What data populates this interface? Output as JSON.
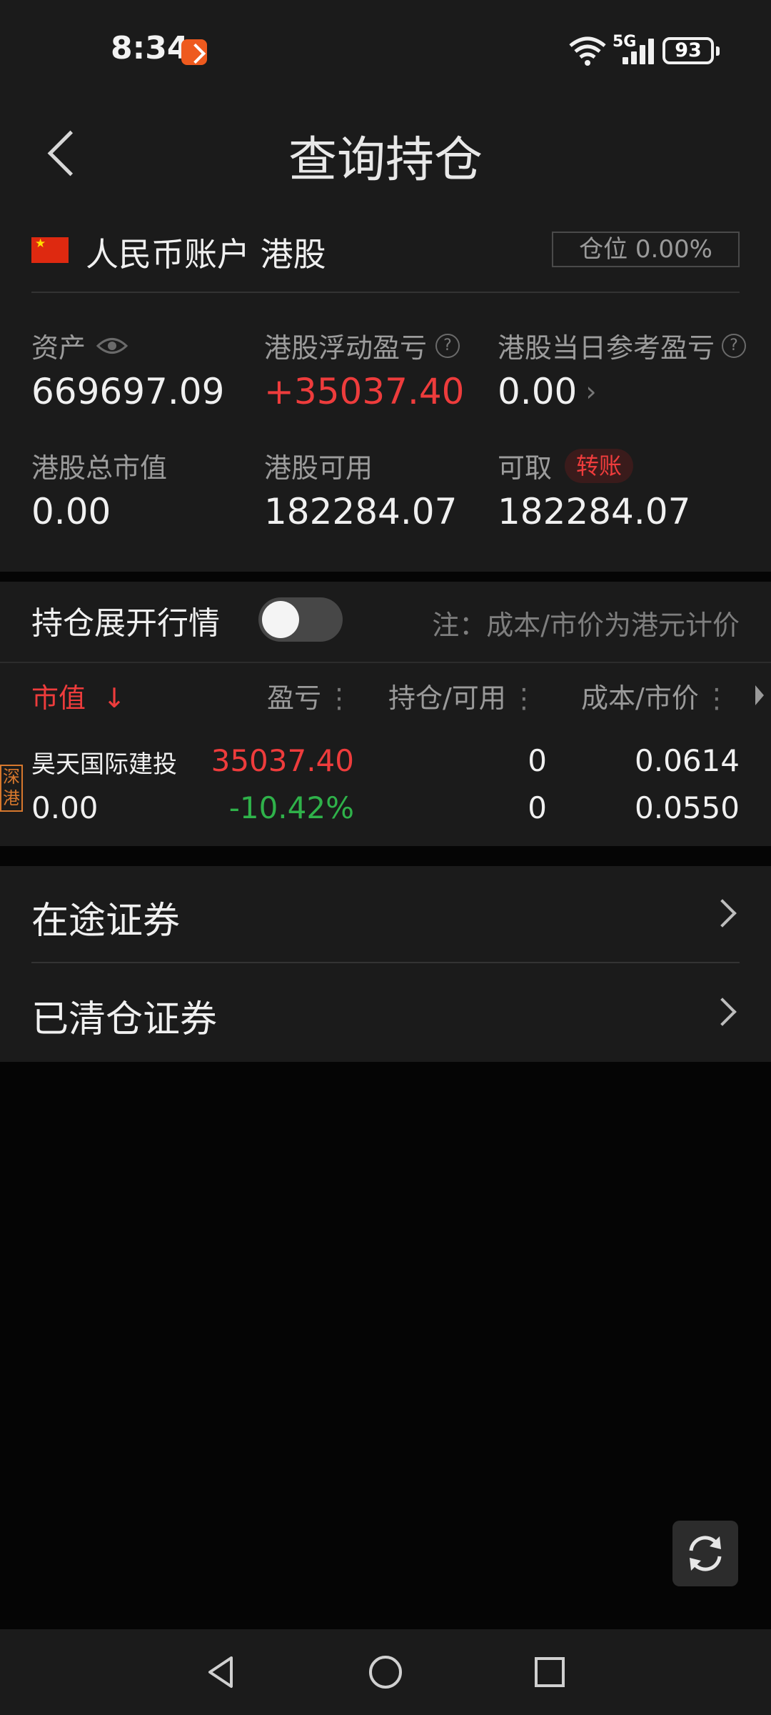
{
  "status_bar": {
    "time": "8:34",
    "network": "5G",
    "battery": "93"
  },
  "header": {
    "title": "查询持仓"
  },
  "account": {
    "name": "人民币账户 港股",
    "position_badge": "仓位 0.00%",
    "assets_label": "资产",
    "assets_value": "669697.09",
    "float_pl_label": "港股浮动盈亏",
    "float_pl_value": "+35037.40",
    "daily_pl_label": "港股当日参考盈亏",
    "daily_pl_value": "0.00",
    "market_value_label": "港股总市值",
    "market_value_value": "0.00",
    "available_label": "港股可用",
    "available_value": "182284.07",
    "withdrawable_label": "可取",
    "withdrawable_value": "182284.07",
    "transfer_label": "转账"
  },
  "holdings": {
    "expand_label": "持仓展开行情",
    "toggle_on": false,
    "note": "注：成本/市价为港元计价",
    "columns": {
      "market_value": "市值",
      "sort_arrow": "↓",
      "profit_loss": "盈亏",
      "holding_available": "持仓/可用",
      "cost_price": "成本/市价",
      "more": "⋮"
    },
    "rows": [
      {
        "market_tag": "深港",
        "name": "昊天国际建投",
        "market_value": "0.00",
        "profit_loss": "35037.40",
        "profit_loss_pct": "-10.42%",
        "holding": "0",
        "available": "0",
        "cost": "0.0614",
        "price": "0.0550"
      }
    ]
  },
  "list": {
    "items": [
      {
        "label": "在途证券"
      },
      {
        "label": "已清仓证券"
      }
    ]
  },
  "colors": {
    "background": "#050505",
    "panel": "#1b1b1b",
    "red": "#ee3c3c",
    "green": "#2fb24a",
    "orange_tag": "#d7782d"
  },
  "icons": [
    "back-arrow-icon",
    "china-flag-icon",
    "eye-icon",
    "help-icon",
    "chevron-right-icon",
    "refresh-icon",
    "nav-back-icon",
    "nav-home-icon",
    "nav-recents-icon"
  ]
}
